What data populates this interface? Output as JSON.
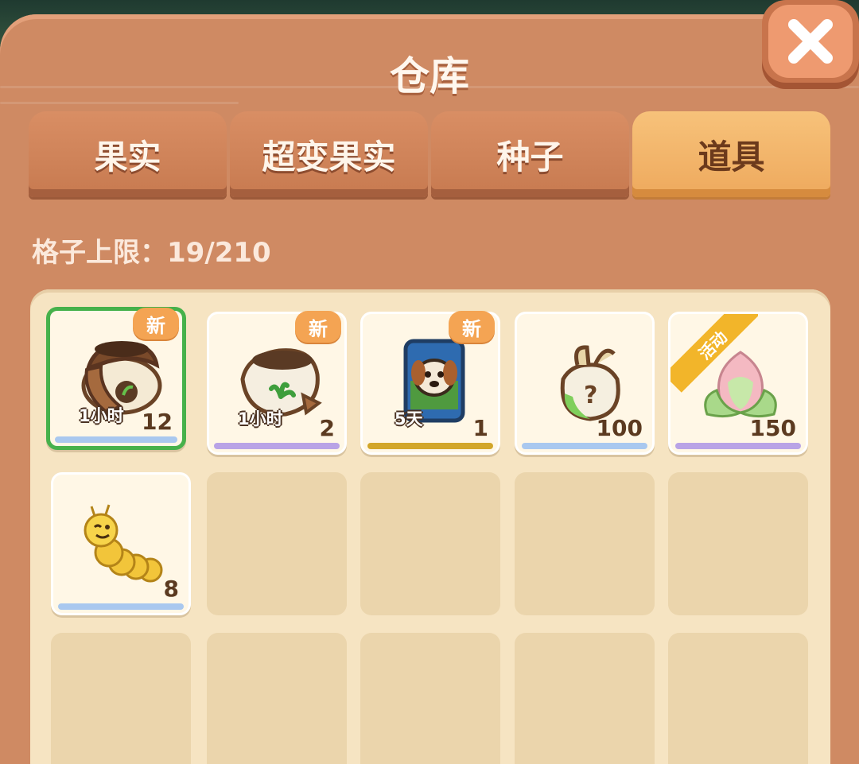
{
  "window": {
    "title": "仓库",
    "close_icon": "close-x-icon"
  },
  "tabs": [
    {
      "label": "果实",
      "active": false
    },
    {
      "label": "超变果实",
      "active": false
    },
    {
      "label": "种子",
      "active": false
    },
    {
      "label": "道具",
      "active": true
    }
  ],
  "capacity": {
    "text": "格子上限：19/210"
  },
  "badges": {
    "new": "新",
    "event": "活动"
  },
  "items": [
    {
      "icon": "fertilizer-bag-icon",
      "count": "12",
      "timer": "1小时",
      "badge": "新",
      "selected": true,
      "rarity_color": "#a9c8ef"
    },
    {
      "icon": "organic-fertilizer-bag-icon",
      "count": "2",
      "timer": "1小时",
      "badge": "新",
      "selected": false,
      "rarity_color": "#b9a3e6"
    },
    {
      "icon": "dog-food-bag-icon",
      "count": "1",
      "timer": "5天",
      "badge": "新",
      "selected": false,
      "rarity_color": "#d2a62a"
    },
    {
      "icon": "mystery-seed-bag-icon",
      "count": "100",
      "selected": false,
      "rarity_color": "#a9c8ef"
    },
    {
      "icon": "lotus-bud-icon",
      "count": "150",
      "badge": "活动",
      "selected": false,
      "rarity_color": "#b9a3e6"
    },
    {
      "icon": "caterpillar-icon",
      "count": "8",
      "selected": false,
      "rarity_color": "#a9c8ef"
    }
  ],
  "colors": {
    "panel": "#cf8a63",
    "active_tab": "#f2b56c",
    "selection": "#46b14b",
    "badge": "#f4a453"
  }
}
